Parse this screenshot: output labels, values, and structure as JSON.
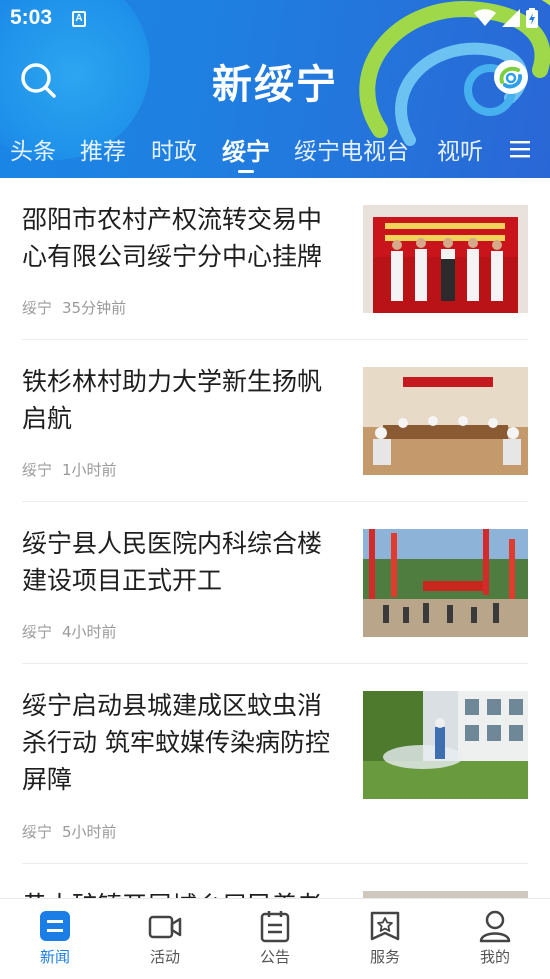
{
  "status_bar": {
    "time": "5:03",
    "notification_icon": "A"
  },
  "header": {
    "app_title": "新绥宁",
    "search_icon": "search-icon",
    "logo_icon": "app-logo-icon",
    "menu_icon": "menu-icon"
  },
  "tabs": [
    {
      "label": "头条",
      "active": false
    },
    {
      "label": "推荐",
      "active": false
    },
    {
      "label": "时政",
      "active": false
    },
    {
      "label": "绥宁",
      "active": true
    },
    {
      "label": "绥宁电视台",
      "active": false
    },
    {
      "label": "视听",
      "active": false
    }
  ],
  "news": [
    {
      "title": "邵阳市农村产权流转交易中心有限公司绥宁分中心挂牌",
      "source": "绥宁",
      "time": "35分钟前"
    },
    {
      "title": "铁杉林村助力大学新生扬帆启航",
      "source": "绥宁",
      "time": "1小时前"
    },
    {
      "title": "绥宁县人民医院内科综合楼建设项目正式开工",
      "source": "绥宁",
      "time": "4小时前"
    },
    {
      "title": "绥宁启动县城建成区蚊虫消杀行动 筑牢蚊媒传染病防控屏障",
      "source": "绥宁",
      "time": "5小时前"
    },
    {
      "title": "黄土矿镇开展城乡居民养老",
      "source": "",
      "time": ""
    }
  ],
  "bottom_nav": [
    {
      "label": "新闻",
      "icon": "news-icon",
      "active": true
    },
    {
      "label": "活动",
      "icon": "video-camera-icon",
      "active": false
    },
    {
      "label": "公告",
      "icon": "notice-icon",
      "active": false
    },
    {
      "label": "服务",
      "icon": "service-star-icon",
      "active": false
    },
    {
      "label": "我的",
      "icon": "user-icon",
      "active": false
    }
  ],
  "colors": {
    "header_blue": "#1f7fe0",
    "accent": "#1a7ee6",
    "swirl_green": "#9fd94a"
  }
}
